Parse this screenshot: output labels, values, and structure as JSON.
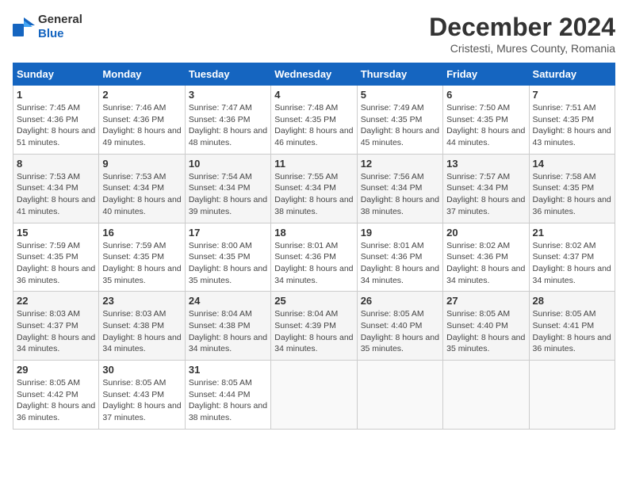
{
  "header": {
    "logo_general": "General",
    "logo_blue": "Blue",
    "title": "December 2024",
    "subtitle": "Cristesti, Mures County, Romania"
  },
  "calendar": {
    "days_of_week": [
      "Sunday",
      "Monday",
      "Tuesday",
      "Wednesday",
      "Thursday",
      "Friday",
      "Saturday"
    ],
    "weeks": [
      [
        null,
        null,
        null,
        null,
        null,
        null,
        null
      ]
    ],
    "cells": [
      {
        "day": 1,
        "col": 0,
        "sunrise": "7:45 AM",
        "sunset": "4:36 PM",
        "daylight": "8 hours and 51 minutes."
      },
      {
        "day": 2,
        "col": 1,
        "sunrise": "7:46 AM",
        "sunset": "4:36 PM",
        "daylight": "8 hours and 49 minutes."
      },
      {
        "day": 3,
        "col": 2,
        "sunrise": "7:47 AM",
        "sunset": "4:36 PM",
        "daylight": "8 hours and 48 minutes."
      },
      {
        "day": 4,
        "col": 3,
        "sunrise": "7:48 AM",
        "sunset": "4:35 PM",
        "daylight": "8 hours and 46 minutes."
      },
      {
        "day": 5,
        "col": 4,
        "sunrise": "7:49 AM",
        "sunset": "4:35 PM",
        "daylight": "8 hours and 45 minutes."
      },
      {
        "day": 6,
        "col": 5,
        "sunrise": "7:50 AM",
        "sunset": "4:35 PM",
        "daylight": "8 hours and 44 minutes."
      },
      {
        "day": 7,
        "col": 6,
        "sunrise": "7:51 AM",
        "sunset": "4:35 PM",
        "daylight": "8 hours and 43 minutes."
      },
      {
        "day": 8,
        "col": 0,
        "sunrise": "7:53 AM",
        "sunset": "4:34 PM",
        "daylight": "8 hours and 41 minutes."
      },
      {
        "day": 9,
        "col": 1,
        "sunrise": "7:53 AM",
        "sunset": "4:34 PM",
        "daylight": "8 hours and 40 minutes."
      },
      {
        "day": 10,
        "col": 2,
        "sunrise": "7:54 AM",
        "sunset": "4:34 PM",
        "daylight": "8 hours and 39 minutes."
      },
      {
        "day": 11,
        "col": 3,
        "sunrise": "7:55 AM",
        "sunset": "4:34 PM",
        "daylight": "8 hours and 38 minutes."
      },
      {
        "day": 12,
        "col": 4,
        "sunrise": "7:56 AM",
        "sunset": "4:34 PM",
        "daylight": "8 hours and 38 minutes."
      },
      {
        "day": 13,
        "col": 5,
        "sunrise": "7:57 AM",
        "sunset": "4:34 PM",
        "daylight": "8 hours and 37 minutes."
      },
      {
        "day": 14,
        "col": 6,
        "sunrise": "7:58 AM",
        "sunset": "4:35 PM",
        "daylight": "8 hours and 36 minutes."
      },
      {
        "day": 15,
        "col": 0,
        "sunrise": "7:59 AM",
        "sunset": "4:35 PM",
        "daylight": "8 hours and 36 minutes."
      },
      {
        "day": 16,
        "col": 1,
        "sunrise": "7:59 AM",
        "sunset": "4:35 PM",
        "daylight": "8 hours and 35 minutes."
      },
      {
        "day": 17,
        "col": 2,
        "sunrise": "8:00 AM",
        "sunset": "4:35 PM",
        "daylight": "8 hours and 35 minutes."
      },
      {
        "day": 18,
        "col": 3,
        "sunrise": "8:01 AM",
        "sunset": "4:36 PM",
        "daylight": "8 hours and 34 minutes."
      },
      {
        "day": 19,
        "col": 4,
        "sunrise": "8:01 AM",
        "sunset": "4:36 PM",
        "daylight": "8 hours and 34 minutes."
      },
      {
        "day": 20,
        "col": 5,
        "sunrise": "8:02 AM",
        "sunset": "4:36 PM",
        "daylight": "8 hours and 34 minutes."
      },
      {
        "day": 21,
        "col": 6,
        "sunrise": "8:02 AM",
        "sunset": "4:37 PM",
        "daylight": "8 hours and 34 minutes."
      },
      {
        "day": 22,
        "col": 0,
        "sunrise": "8:03 AM",
        "sunset": "4:37 PM",
        "daylight": "8 hours and 34 minutes."
      },
      {
        "day": 23,
        "col": 1,
        "sunrise": "8:03 AM",
        "sunset": "4:38 PM",
        "daylight": "8 hours and 34 minutes."
      },
      {
        "day": 24,
        "col": 2,
        "sunrise": "8:04 AM",
        "sunset": "4:38 PM",
        "daylight": "8 hours and 34 minutes."
      },
      {
        "day": 25,
        "col": 3,
        "sunrise": "8:04 AM",
        "sunset": "4:39 PM",
        "daylight": "8 hours and 34 minutes."
      },
      {
        "day": 26,
        "col": 4,
        "sunrise": "8:05 AM",
        "sunset": "4:40 PM",
        "daylight": "8 hours and 35 minutes."
      },
      {
        "day": 27,
        "col": 5,
        "sunrise": "8:05 AM",
        "sunset": "4:40 PM",
        "daylight": "8 hours and 35 minutes."
      },
      {
        "day": 28,
        "col": 6,
        "sunrise": "8:05 AM",
        "sunset": "4:41 PM",
        "daylight": "8 hours and 36 minutes."
      },
      {
        "day": 29,
        "col": 0,
        "sunrise": "8:05 AM",
        "sunset": "4:42 PM",
        "daylight": "8 hours and 36 minutes."
      },
      {
        "day": 30,
        "col": 1,
        "sunrise": "8:05 AM",
        "sunset": "4:43 PM",
        "daylight": "8 hours and 37 minutes."
      },
      {
        "day": 31,
        "col": 2,
        "sunrise": "8:05 AM",
        "sunset": "4:44 PM",
        "daylight": "8 hours and 38 minutes."
      }
    ]
  }
}
